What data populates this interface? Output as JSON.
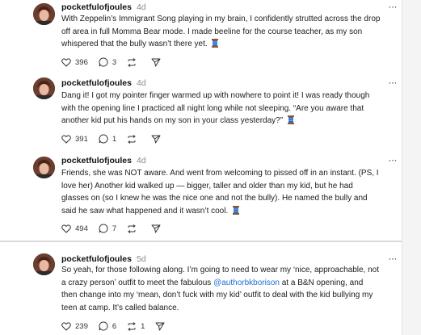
{
  "posts": [
    {
      "username": "pocketfulofjoules",
      "time": "4d",
      "more": "···",
      "text": "With Zeppelin’s Immigrant Song playing in my brain, I confidently strutted across the drop off area in full Momma Bear mode. I made beeline for the course teacher, as my son whispered that the bully wasn’t there yet.",
      "likes": "396",
      "replies": "3",
      "reposts": ""
    },
    {
      "username": "pocketfulofjoules",
      "time": "4d",
      "more": "···",
      "text": "Dang it! I got my pointer finger warmed up with nowhere to point it! I was ready though with the opening line I practiced all night long while not sleeping. “Are you aware that another kid put his hands on my son in your class yesterday?”",
      "likes": "391",
      "replies": "1",
      "reposts": ""
    },
    {
      "username": "pocketfulofjoules",
      "time": "4d",
      "more": "···",
      "text": "Friends, she was NOT aware. And went from welcoming to pissed off in an instant. (PS, I love her) Another kid walked up — bigger, taller and older than my kid, but he had glasses on (so I knew he was the nice one and not the bully). He named the bully and said he saw what happened and it wasn’t cool.",
      "likes": "494",
      "replies": "7",
      "reposts": ""
    },
    {
      "username": "pocketfulofjoules",
      "time": "5d",
      "more": "···",
      "text_before": "So yeah, for those following along. I’m going to need to wear my ‘nice, approachable, not a crazy person’ outfit to meet the fabulous ",
      "mention": "@authorbkborison",
      "text_after": " at a B&N opening, and then change into my ‘mean, don’t fuck with my kid’ outfit to deal with the kid bullying my teen at camp. It’s called balance.",
      "likes": "239",
      "replies": "6",
      "reposts": "1"
    }
  ],
  "icons": {
    "like": "heart-icon",
    "reply": "comment-icon",
    "repost": "repost-icon",
    "share": "share-icon",
    "emoji": "spool-of-thread-emoji"
  },
  "colors": {
    "mention": "#1d6fd1",
    "spool": "#2f68c4"
  }
}
